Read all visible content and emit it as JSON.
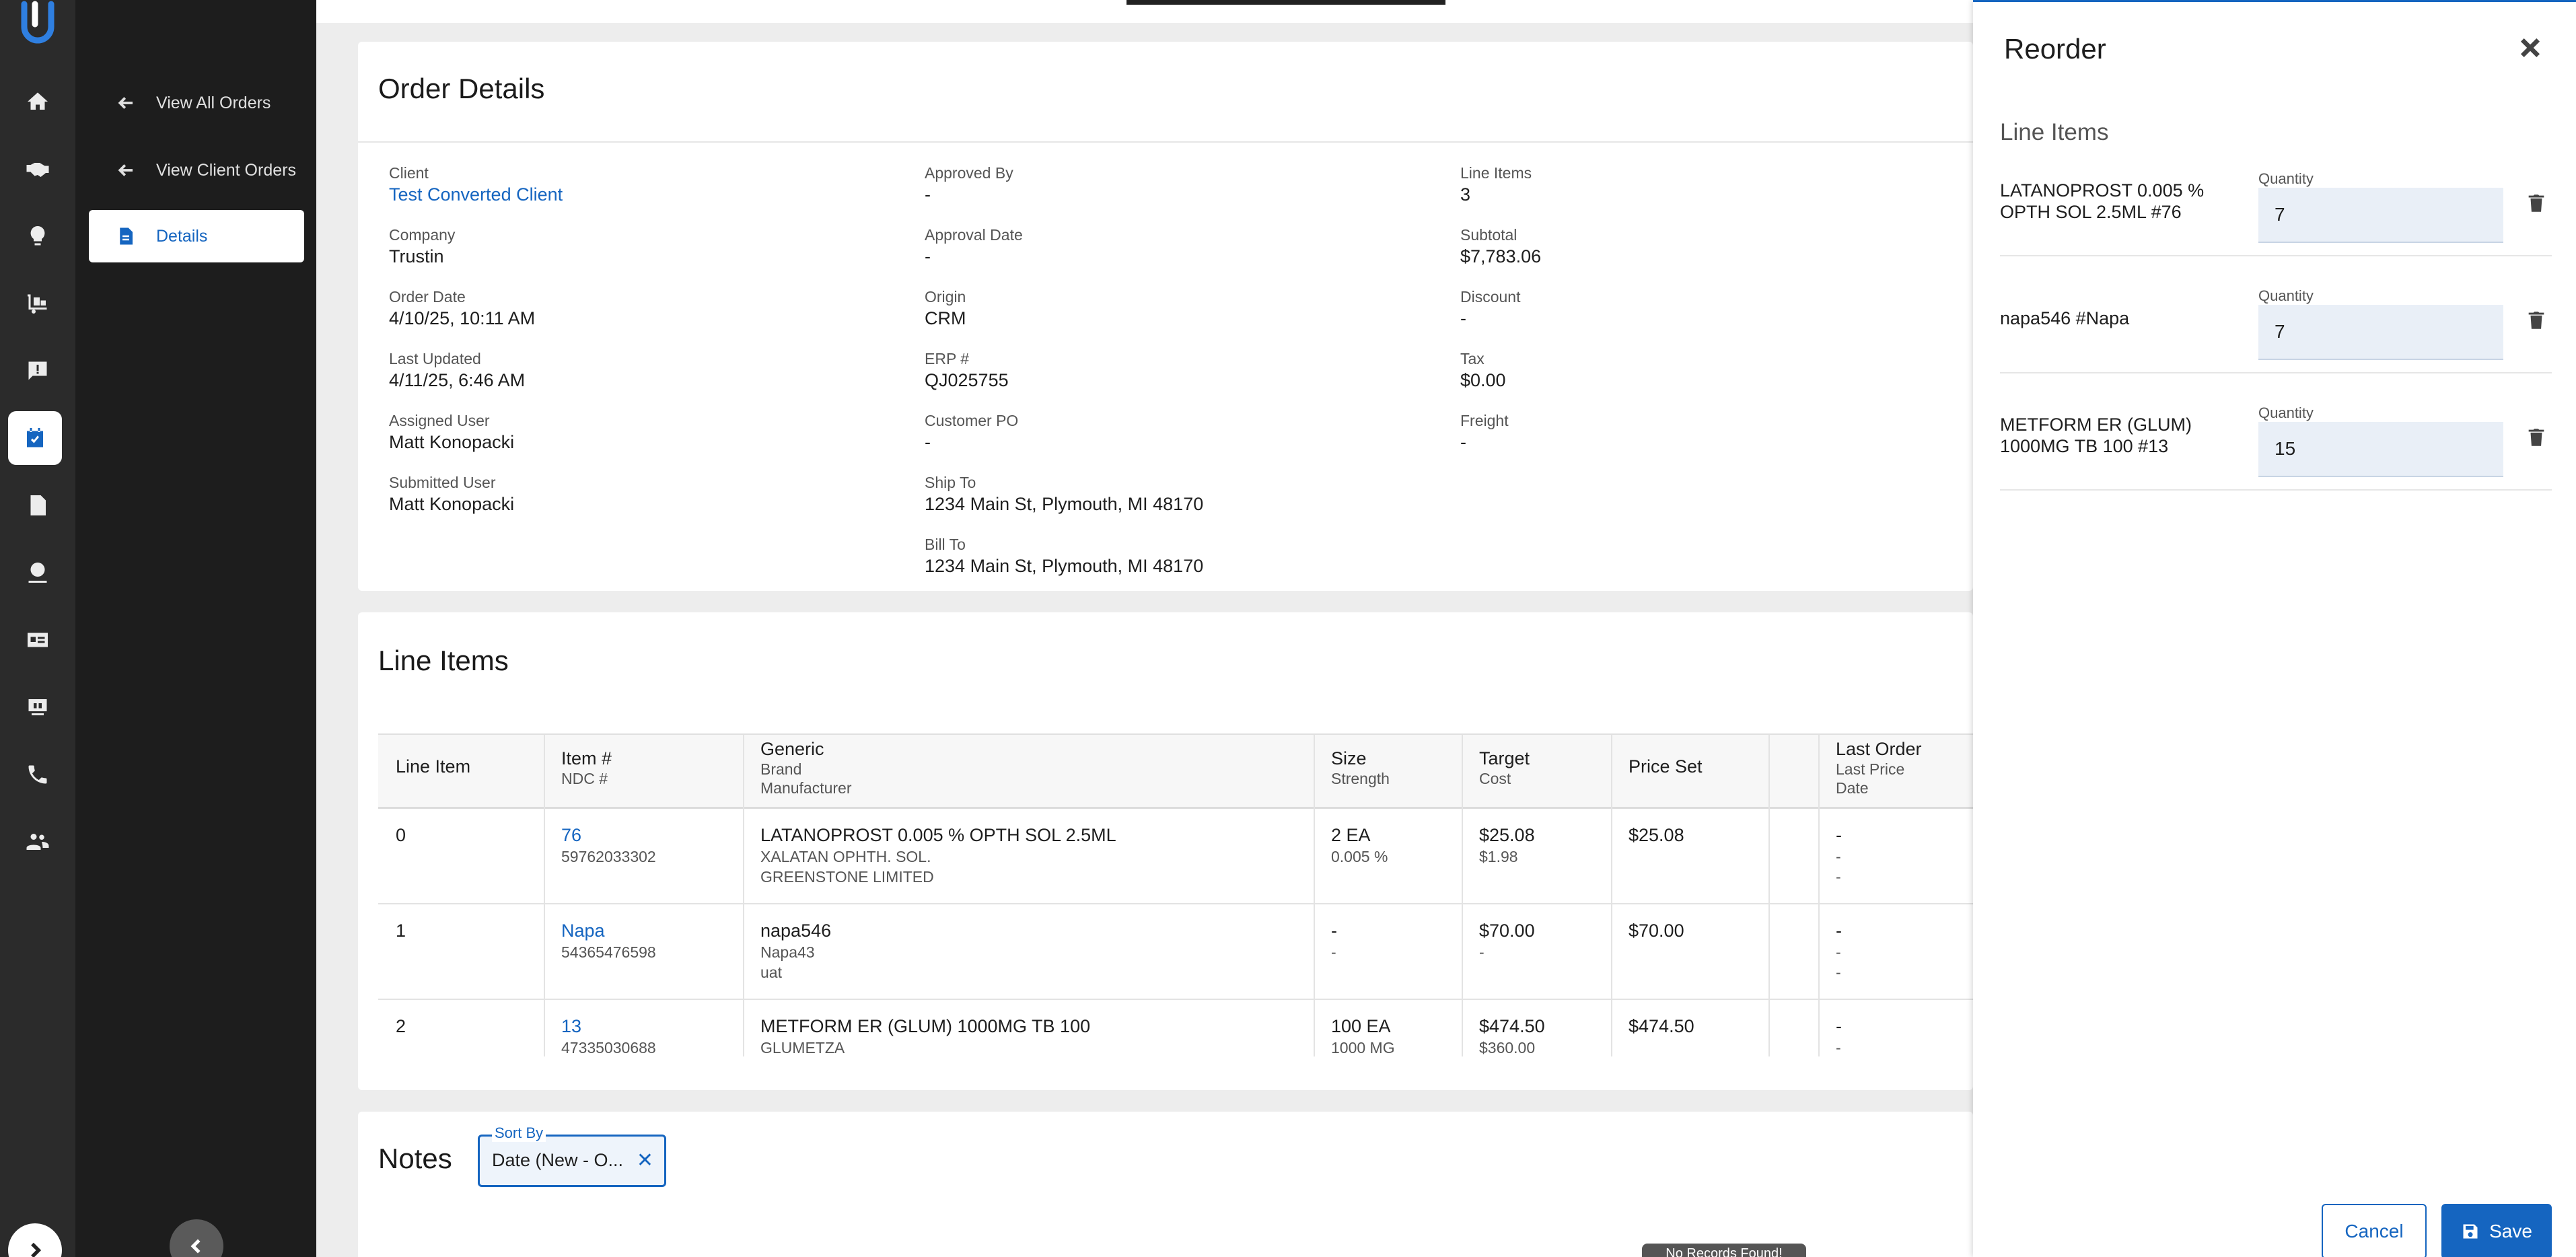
{
  "nav": {
    "view_all_orders": "View All Orders",
    "view_client_orders": "View Client Orders",
    "details": "Details"
  },
  "order_details": {
    "title": "Order Details",
    "fields": {
      "client": {
        "label": "Client",
        "value": "Test Converted Client"
      },
      "company": {
        "label": "Company",
        "value": "Trustin"
      },
      "order_date": {
        "label": "Order Date",
        "value": "4/10/25, 10:11 AM"
      },
      "last_updated": {
        "label": "Last Updated",
        "value": "4/11/25, 6:46 AM"
      },
      "assigned_user": {
        "label": "Assigned User",
        "value": "Matt Konopacki"
      },
      "submitted_user": {
        "label": "Submitted User",
        "value": "Matt Konopacki"
      },
      "approved_by": {
        "label": "Approved By",
        "value": "-"
      },
      "approval_date": {
        "label": "Approval Date",
        "value": "-"
      },
      "origin": {
        "label": "Origin",
        "value": "CRM"
      },
      "erp": {
        "label": "ERP #",
        "value": "QJ025755"
      },
      "customer_po": {
        "label": "Customer PO",
        "value": "-"
      },
      "ship_to": {
        "label": "Ship To",
        "value": "1234 Main St, Plymouth, MI 48170"
      },
      "bill_to": {
        "label": "Bill To",
        "value": "1234 Main St, Plymouth, MI 48170"
      },
      "line_items": {
        "label": "Line Items",
        "value": "3"
      },
      "subtotal": {
        "label": "Subtotal",
        "value": "$7,783.06"
      },
      "discount": {
        "label": "Discount",
        "value": "-"
      },
      "tax": {
        "label": "Tax",
        "value": "$0.00"
      },
      "freight": {
        "label": "Freight",
        "value": "-"
      }
    }
  },
  "line_items": {
    "title": "Line Items",
    "headers": {
      "line_item": "Line Item",
      "item_no": "Item #",
      "ndc": "NDC #",
      "generic": "Generic",
      "brand": "Brand",
      "manufacturer": "Manufacturer",
      "size": "Size",
      "strength": "Strength",
      "target": "Target",
      "cost": "Cost",
      "price_set": "Price Set",
      "last_order": "Last Order",
      "last_price": "Last Price",
      "date": "Date"
    },
    "rows": [
      {
        "line": "0",
        "item": "76",
        "ndc": "59762033302",
        "generic": "LATANOPROST 0.005 % OPTH SOL 2.5ML",
        "brand": "XALATAN OPHTH. SOL.",
        "manufacturer": "GREENSTONE LIMITED",
        "size": "2 EA",
        "strength": "0.005 %",
        "target": "$25.08",
        "cost": "$1.98",
        "price_set": "$25.08",
        "last_order": "-",
        "last_price": "-",
        "date": "-"
      },
      {
        "line": "1",
        "item": "Napa",
        "ndc": "54365476598",
        "generic": "napa546",
        "brand": "Napa43",
        "manufacturer": "uat",
        "size": "-",
        "strength": "-",
        "target": "$70.00",
        "cost": "-",
        "price_set": "$70.00",
        "last_order": "-",
        "last_price": "-",
        "date": "-"
      },
      {
        "line": "2",
        "item": "13",
        "ndc": "47335030688",
        "generic": "METFORM ER (GLUM) 1000MG TB 100",
        "brand": "GLUMETZA",
        "manufacturer": "",
        "size": "100 EA",
        "strength": "1000 MG",
        "target": "$474.50",
        "cost": "$360.00",
        "price_set": "$474.50",
        "last_order": "-",
        "last_price": "-",
        "date": ""
      }
    ]
  },
  "notes": {
    "title": "Notes",
    "sort_label": "Sort By",
    "sort_value": "Date (New - O...",
    "no_records": "No Records Found!"
  },
  "drawer": {
    "title": "Reorder",
    "section": "Line Items",
    "quantity_label": "Quantity",
    "items": [
      {
        "name": "LATANOPROST 0.005 % OPTH SOL 2.5ML #76",
        "quantity": "7"
      },
      {
        "name": "napa546 #Napa",
        "quantity": "7"
      },
      {
        "name": "METFORM ER (GLUM) 1000MG TB 100 #13",
        "quantity": "15"
      }
    ],
    "cancel": "Cancel",
    "save": "Save"
  }
}
